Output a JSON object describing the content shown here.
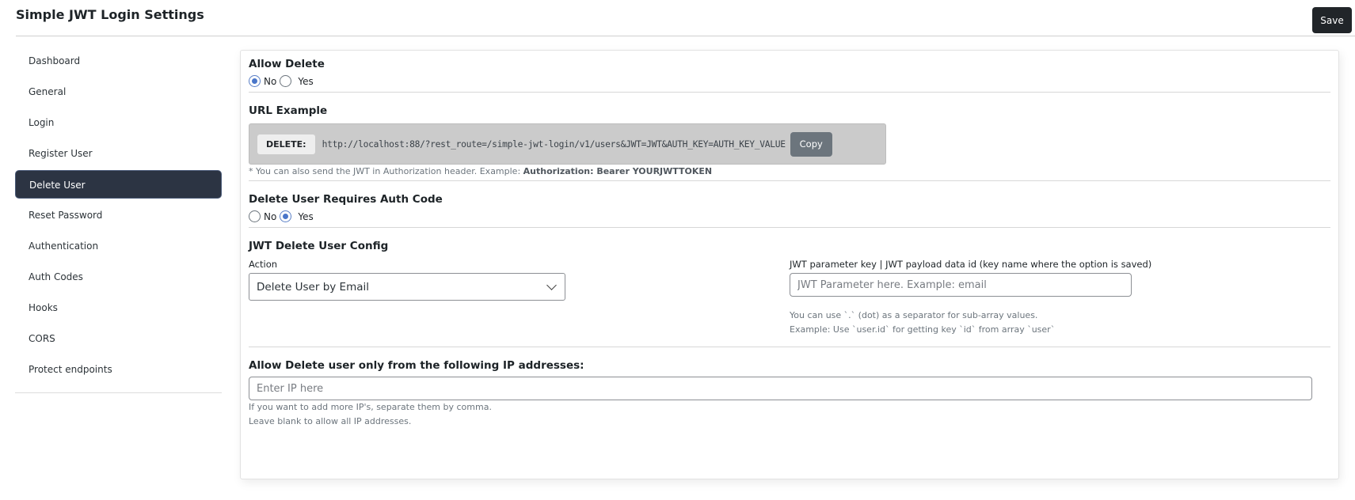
{
  "header": {
    "title": "Simple JWT Login Settings",
    "save_label": "Save"
  },
  "sidebar": {
    "items": [
      {
        "label": "Dashboard",
        "active": false
      },
      {
        "label": "General",
        "active": false
      },
      {
        "label": "Login",
        "active": false
      },
      {
        "label": "Register User",
        "active": false
      },
      {
        "label": "Delete User",
        "active": true
      },
      {
        "label": "Reset Password",
        "active": false
      },
      {
        "label": "Authentication",
        "active": false
      },
      {
        "label": "Auth Codes",
        "active": false
      },
      {
        "label": "Hooks",
        "active": false
      },
      {
        "label": "CORS",
        "active": false
      },
      {
        "label": "Protect endpoints",
        "active": false
      }
    ]
  },
  "allow_delete": {
    "title": "Allow Delete",
    "options": [
      "No",
      "Yes"
    ],
    "selected": "No"
  },
  "url_example": {
    "title": "URL Example",
    "method": "DELETE:",
    "url": "http://localhost:88/?rest_route=/simple-jwt-login/v1/users&JWT=JWT&AUTH_KEY=AUTH_KEY_VALUE",
    "copy_label": "Copy",
    "hint_prefix": "* You can also send the JWT in Authorization header. Example: ",
    "hint_bold": "Authorization: Bearer YOURJWTTOKEN"
  },
  "requires_auth_code": {
    "title": "Delete User Requires Auth Code",
    "options": [
      "No",
      "Yes"
    ],
    "selected": "Yes"
  },
  "config": {
    "title": "JWT Delete User Config",
    "action_label": "Action",
    "action_value": "Delete User by Email",
    "jwt_key_label": "JWT parameter key | JWT payload data id (key name where the option is saved)",
    "jwt_key_placeholder": "JWT Parameter here. Example: email",
    "jwt_key_help_1": "You can use `.` (dot) as a separator for sub-array values.",
    "jwt_key_help_2": "Example: Use `user.id` for getting key `id` from array `user`"
  },
  "ip_restriction": {
    "title": "Allow Delete user only from the following IP addresses:",
    "placeholder": "Enter IP here",
    "help_1": "If you want to add more IP's, separate them by comma.",
    "help_2": "Leave blank to allow all IP addresses."
  }
}
